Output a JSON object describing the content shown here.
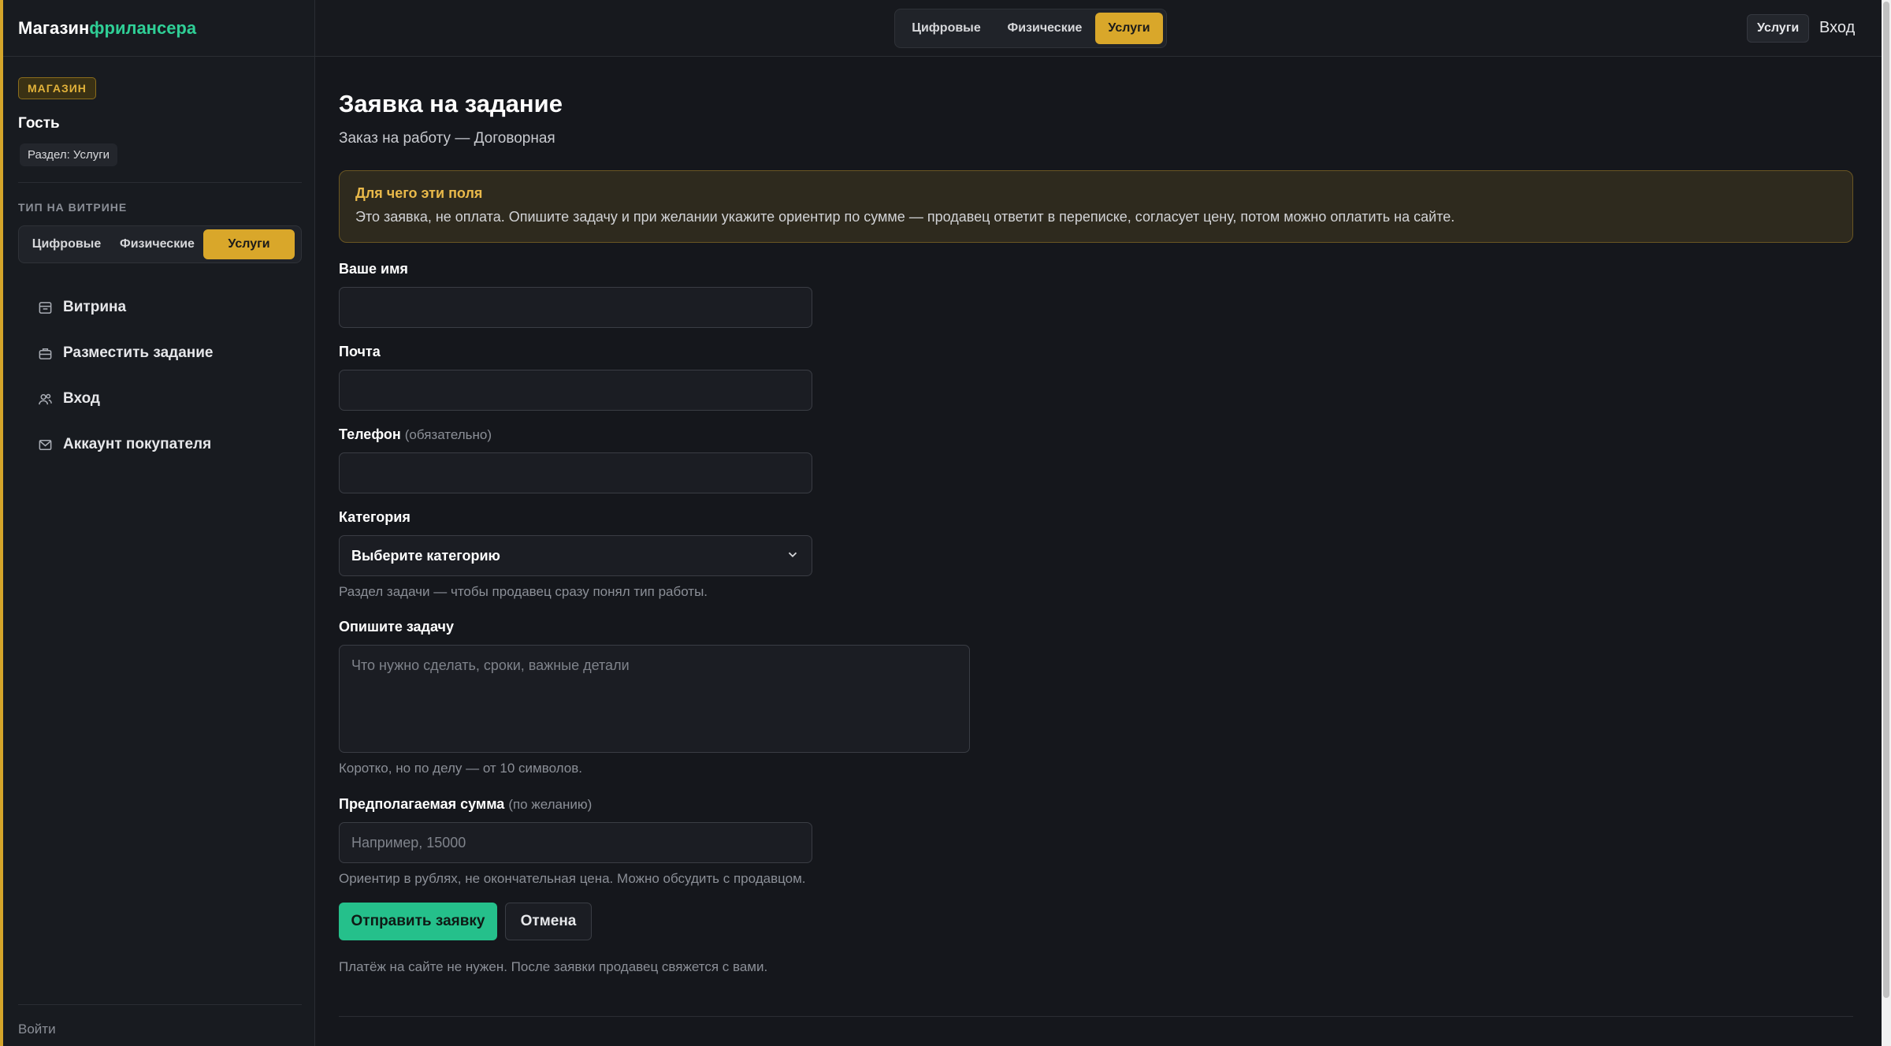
{
  "brand": {
    "part1": "Магазин",
    "part2": "фрилансера"
  },
  "sidebar": {
    "badge": "МАГАЗИН",
    "user": "Гость",
    "section_chip": "Раздел: Услуги",
    "heading": "ТИП НА ВИТРИНЕ",
    "types": [
      "Цифровые",
      "Физические",
      "Услуги"
    ],
    "active_type": "Услуги",
    "items": [
      {
        "label": "Витрина",
        "icon": "storefront-icon"
      },
      {
        "label": "Разместить задание",
        "icon": "briefcase-icon"
      },
      {
        "label": "Вход",
        "icon": "users-icon"
      },
      {
        "label": "Аккаунт покупателя",
        "icon": "mail-icon"
      }
    ],
    "bottom_link": "Войти"
  },
  "topbar": {
    "types": [
      "Цифровые",
      "Физические",
      "Услуги"
    ],
    "chip": "Услуги",
    "login": "Вход"
  },
  "page": {
    "title": "Заявка на задание",
    "subtitle": "Заказ на работу — Договорная",
    "notice_title": "Для чего эти поля",
    "notice_text": "Это заявка, не оплата. Опишите задачу и при желании укажите ориентир по сумме — продавец ответит в переписке, согласует цену, потом можно оплатить на сайте."
  },
  "form": {
    "name_label": "Ваше имя",
    "name_value": "",
    "email_label": "Почта",
    "email_value": "",
    "phone_label": "Телефон",
    "phone_note": "(обязательно)",
    "phone_value": "",
    "category_label": "Категория",
    "category_value": "Выберите категорию",
    "category_hint": "Раздел задачи — чтобы продавец сразу понял тип работы.",
    "task_label": "Опишите задачу",
    "task_placeholder": "Что нужно сделать, сроки, важные детали",
    "task_hint": "Коротко, но по делу — от 10 символов.",
    "amount_label": "Предполагаемая сумма",
    "amount_note": "(по желанию)",
    "amount_placeholder": "Например, 15000",
    "amount_hint": "Ориентир в рублях, не окончательная цена. Можно обсудить с продавцом.",
    "submit": "Отправить заявку",
    "cancel": "Отмена",
    "footer_note": "Платёж на сайте не нужен. После заявки продавец свяжется с вами."
  },
  "colors": {
    "accent": "#d9a72a",
    "brand_green": "#2fcf96",
    "primary_button": "#25c08b"
  }
}
